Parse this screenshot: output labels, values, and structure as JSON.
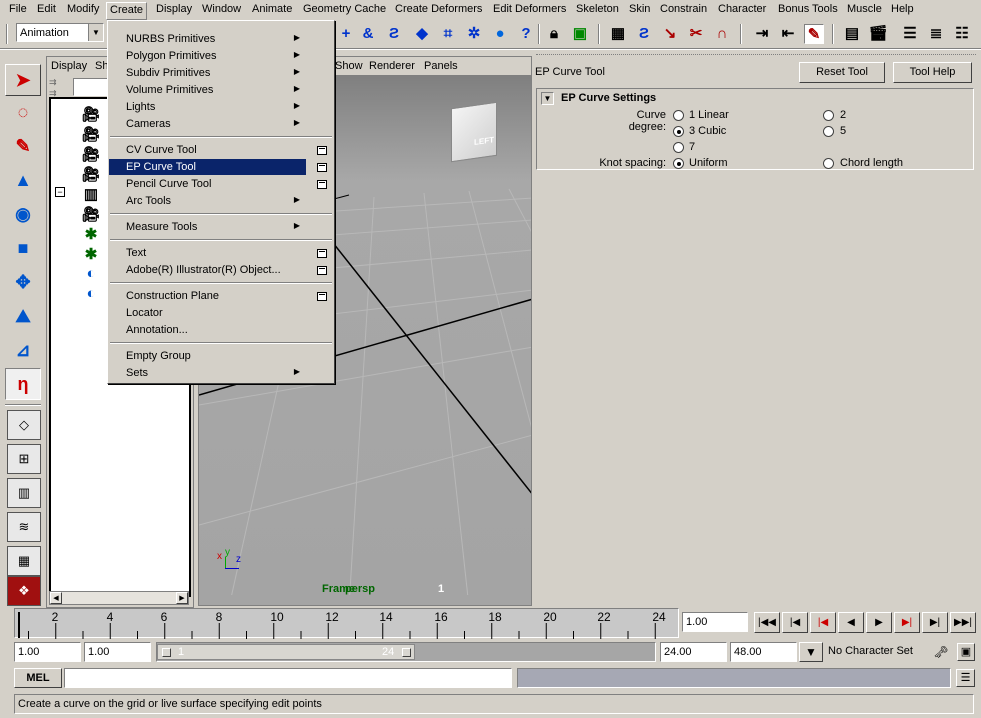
{
  "menubar": {
    "items": [
      "File",
      "Edit",
      "Modify",
      "Create",
      "Display",
      "Window",
      "Animate",
      "Geometry Cache",
      "Create Deformers",
      "Edit Deformers",
      "Skeleton",
      "Skin",
      "Constrain",
      "Character",
      "Bonus Tools",
      "Muscle",
      "Help"
    ],
    "selected": "Create"
  },
  "toolbar": {
    "mode_value": "Animation"
  },
  "outliner": {
    "menu_display": "Display",
    "menu_show": "Sh"
  },
  "viewport": {
    "menu_show": "Show",
    "menu_renderer": "Renderer",
    "menu_panels": "Panels",
    "view_cube_label": "LEFT",
    "frame_rate_label": "Frame",
    "camera_label": "persp",
    "frame_count": "1",
    "axis_x": "x",
    "axis_y": "y",
    "axis_z": "z"
  },
  "create_menu": {
    "items": [
      {
        "label": "NURBS Primitives",
        "submenu": true
      },
      {
        "label": "Polygon Primitives",
        "submenu": true
      },
      {
        "label": "Subdiv Primitives",
        "submenu": true
      },
      {
        "label": "Volume Primitives",
        "submenu": true
      },
      {
        "label": "Lights",
        "submenu": true
      },
      {
        "label": "Cameras",
        "submenu": true
      },
      {
        "label": "CV Curve Tool",
        "option": true
      },
      {
        "label": "EP Curve Tool",
        "option": true,
        "highlighted": true
      },
      {
        "label": "Pencil Curve Tool",
        "option": true
      },
      {
        "label": "Arc Tools",
        "submenu": true
      },
      {
        "label": "Measure Tools",
        "submenu": true
      },
      {
        "label": "Text",
        "option": true
      },
      {
        "label": "Adobe(R) Illustrator(R) Object...",
        "option": true
      },
      {
        "label": "Construction Plane",
        "option": true
      },
      {
        "label": "Locator"
      },
      {
        "label": "Annotation..."
      },
      {
        "label": "Empty Group"
      },
      {
        "label": "Sets",
        "submenu": true
      }
    ]
  },
  "tool_settings": {
    "title": "EP Curve Tool",
    "reset_label": "Reset Tool",
    "help_label": "Tool Help",
    "section_title": "EP Curve Settings",
    "curve_degree_label": "Curve degree:",
    "degree_options": [
      "1 Linear",
      "3 Cubic",
      "7",
      "2",
      "5"
    ],
    "degree_selected": "3 Cubic",
    "knot_spacing_label": "Knot spacing:",
    "knot_options": [
      "Uniform",
      "Chord length"
    ],
    "knot_selected": "Uniform"
  },
  "timeline": {
    "ticks": [
      "2",
      "4",
      "6",
      "8",
      "10",
      "12",
      "14",
      "16",
      "18",
      "20",
      "22",
      "24"
    ],
    "current_time": "1.00"
  },
  "range": {
    "start_time": "1.00",
    "playback_start": "1.00",
    "slider_start": "1",
    "slider_end": "24",
    "playback_end": "24.00",
    "end_time": "48.00",
    "character_set": "No Character Set"
  },
  "command_line": {
    "label": "MEL",
    "value": ""
  },
  "help_line": {
    "text": "Create a curve on the grid or live surface specifying edit points"
  },
  "colors": {
    "menu_highlight": "#0a246a",
    "ui_gray": "#d4d0c8",
    "viewport_gray": "#a0a0a0"
  }
}
